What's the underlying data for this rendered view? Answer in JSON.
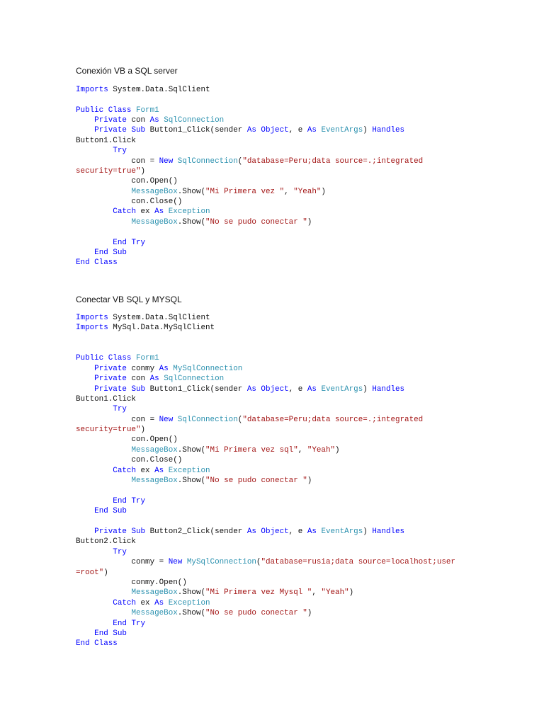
{
  "sections": [
    {
      "title": "Conexión VB a SQL server",
      "lines": [
        [
          [
            "k",
            "Imports"
          ],
          [
            "p",
            " System.Data.SqlClient"
          ]
        ],
        [],
        [
          [
            "k",
            "Public Class"
          ],
          [
            "p",
            " "
          ],
          [
            "t",
            "Form1"
          ]
        ],
        [
          [
            "p",
            "    "
          ],
          [
            "k",
            "Private"
          ],
          [
            "p",
            " con "
          ],
          [
            "k",
            "As"
          ],
          [
            "p",
            " "
          ],
          [
            "t",
            "SqlConnection"
          ]
        ],
        [
          [
            "p",
            "    "
          ],
          [
            "k",
            "Private Sub"
          ],
          [
            "p",
            " Button1_Click(sender "
          ],
          [
            "k",
            "As Object"
          ],
          [
            "p",
            ", e "
          ],
          [
            "k",
            "As"
          ],
          [
            "p",
            " "
          ],
          [
            "t",
            "EventArgs"
          ],
          [
            "p",
            ") "
          ],
          [
            "k",
            "Handles"
          ]
        ],
        [
          [
            "p",
            "Button1.Click"
          ]
        ],
        [
          [
            "p",
            "        "
          ],
          [
            "k",
            "Try"
          ]
        ],
        [
          [
            "p",
            "            con = "
          ],
          [
            "k",
            "New"
          ],
          [
            "p",
            " "
          ],
          [
            "t",
            "SqlConnection"
          ],
          [
            "p",
            "("
          ],
          [
            "s",
            "\"database=Peru;data source=.;integrated"
          ]
        ],
        [
          [
            "s",
            "security=true\""
          ],
          [
            "p",
            ")"
          ]
        ],
        [
          [
            "p",
            "            con.Open()"
          ]
        ],
        [
          [
            "p",
            "            "
          ],
          [
            "t",
            "MessageBox"
          ],
          [
            "p",
            ".Show("
          ],
          [
            "s",
            "\"Mi Primera vez \""
          ],
          [
            "p",
            ", "
          ],
          [
            "s",
            "\"Yeah\""
          ],
          [
            "p",
            ")"
          ]
        ],
        [
          [
            "p",
            "            con.Close()"
          ]
        ],
        [
          [
            "p",
            "        "
          ],
          [
            "k",
            "Catch"
          ],
          [
            "p",
            " ex "
          ],
          [
            "k",
            "As"
          ],
          [
            "p",
            " "
          ],
          [
            "t",
            "Exception"
          ]
        ],
        [
          [
            "p",
            "            "
          ],
          [
            "t",
            "MessageBox"
          ],
          [
            "p",
            ".Show("
          ],
          [
            "s",
            "\"No se pudo conectar \""
          ],
          [
            "p",
            ")"
          ]
        ],
        [],
        [
          [
            "p",
            "        "
          ],
          [
            "k",
            "End Try"
          ]
        ],
        [
          [
            "p",
            "    "
          ],
          [
            "k",
            "End Sub"
          ]
        ],
        [
          [
            "k",
            "End Class"
          ]
        ]
      ]
    },
    {
      "title": "Conectar VB  SQL y MYSQL",
      "lines": [
        [
          [
            "k",
            "Imports"
          ],
          [
            "p",
            " System.Data.SqlClient"
          ]
        ],
        [
          [
            "k",
            "Imports"
          ],
          [
            "p",
            " MySql.Data.MySqlClient"
          ]
        ],
        [],
        [],
        [
          [
            "k",
            "Public Class"
          ],
          [
            "p",
            " "
          ],
          [
            "t",
            "Form1"
          ]
        ],
        [
          [
            "p",
            "    "
          ],
          [
            "k",
            "Private"
          ],
          [
            "p",
            " conmy "
          ],
          [
            "k",
            "As"
          ],
          [
            "p",
            " "
          ],
          [
            "t",
            "MySqlConnection"
          ]
        ],
        [
          [
            "p",
            "    "
          ],
          [
            "k",
            "Private"
          ],
          [
            "p",
            " con "
          ],
          [
            "k",
            "As"
          ],
          [
            "p",
            " "
          ],
          [
            "t",
            "SqlConnection"
          ]
        ],
        [
          [
            "p",
            "    "
          ],
          [
            "k",
            "Private Sub"
          ],
          [
            "p",
            " Button1_Click(sender "
          ],
          [
            "k",
            "As Object"
          ],
          [
            "p",
            ", e "
          ],
          [
            "k",
            "As"
          ],
          [
            "p",
            " "
          ],
          [
            "t",
            "EventArgs"
          ],
          [
            "p",
            ") "
          ],
          [
            "k",
            "Handles"
          ]
        ],
        [
          [
            "p",
            "Button1.Click"
          ]
        ],
        [
          [
            "p",
            "        "
          ],
          [
            "k",
            "Try"
          ]
        ],
        [
          [
            "p",
            "            con = "
          ],
          [
            "k",
            "New"
          ],
          [
            "p",
            " "
          ],
          [
            "t",
            "SqlConnection"
          ],
          [
            "p",
            "("
          ],
          [
            "s",
            "\"database=Peru;data source=.;integrated"
          ]
        ],
        [
          [
            "s",
            "security=true\""
          ],
          [
            "p",
            ")"
          ]
        ],
        [
          [
            "p",
            "            con.Open()"
          ]
        ],
        [
          [
            "p",
            "            "
          ],
          [
            "t",
            "MessageBox"
          ],
          [
            "p",
            ".Show("
          ],
          [
            "s",
            "\"Mi Primera vez sql\""
          ],
          [
            "p",
            ", "
          ],
          [
            "s",
            "\"Yeah\""
          ],
          [
            "p",
            ")"
          ]
        ],
        [
          [
            "p",
            "            con.Close()"
          ]
        ],
        [
          [
            "p",
            "        "
          ],
          [
            "k",
            "Catch"
          ],
          [
            "p",
            " ex "
          ],
          [
            "k",
            "As"
          ],
          [
            "p",
            " "
          ],
          [
            "t",
            "Exception"
          ]
        ],
        [
          [
            "p",
            "            "
          ],
          [
            "t",
            "MessageBox"
          ],
          [
            "p",
            ".Show("
          ],
          [
            "s",
            "\"No se pudo conectar \""
          ],
          [
            "p",
            ")"
          ]
        ],
        [],
        [
          [
            "p",
            "        "
          ],
          [
            "k",
            "End Try"
          ]
        ],
        [
          [
            "p",
            "    "
          ],
          [
            "k",
            "End Sub"
          ]
        ],
        [],
        [
          [
            "p",
            "    "
          ],
          [
            "k",
            "Private Sub"
          ],
          [
            "p",
            " Button2_Click(sender "
          ],
          [
            "k",
            "As Object"
          ],
          [
            "p",
            ", e "
          ],
          [
            "k",
            "As"
          ],
          [
            "p",
            " "
          ],
          [
            "t",
            "EventArgs"
          ],
          [
            "p",
            ") "
          ],
          [
            "k",
            "Handles"
          ]
        ],
        [
          [
            "p",
            "Button2.Click"
          ]
        ],
        [
          [
            "p",
            "        "
          ],
          [
            "k",
            "Try"
          ]
        ],
        [
          [
            "p",
            "            conmy = "
          ],
          [
            "k",
            "New"
          ],
          [
            "p",
            " "
          ],
          [
            "t",
            "MySqlConnection"
          ],
          [
            "p",
            "("
          ],
          [
            "s",
            "\"database=rusia;data source=localhost;user"
          ]
        ],
        [
          [
            "s",
            "=root\""
          ],
          [
            "p",
            ")"
          ]
        ],
        [
          [
            "p",
            "            conmy.Open()"
          ]
        ],
        [
          [
            "p",
            "            "
          ],
          [
            "t",
            "MessageBox"
          ],
          [
            "p",
            ".Show("
          ],
          [
            "s",
            "\"Mi Primera vez Mysql \""
          ],
          [
            "p",
            ", "
          ],
          [
            "s",
            "\"Yeah\""
          ],
          [
            "p",
            ")"
          ]
        ],
        [
          [
            "p",
            "        "
          ],
          [
            "k",
            "Catch"
          ],
          [
            "p",
            " ex "
          ],
          [
            "k",
            "As"
          ],
          [
            "p",
            " "
          ],
          [
            "t",
            "Exception"
          ]
        ],
        [
          [
            "p",
            "            "
          ],
          [
            "t",
            "MessageBox"
          ],
          [
            "p",
            ".Show("
          ],
          [
            "s",
            "\"No se pudo conectar \""
          ],
          [
            "p",
            ")"
          ]
        ],
        [
          [
            "p",
            "        "
          ],
          [
            "k",
            "End Try"
          ]
        ],
        [
          [
            "p",
            "    "
          ],
          [
            "k",
            "End Sub"
          ]
        ],
        [
          [
            "k",
            "End Class"
          ]
        ]
      ]
    }
  ]
}
